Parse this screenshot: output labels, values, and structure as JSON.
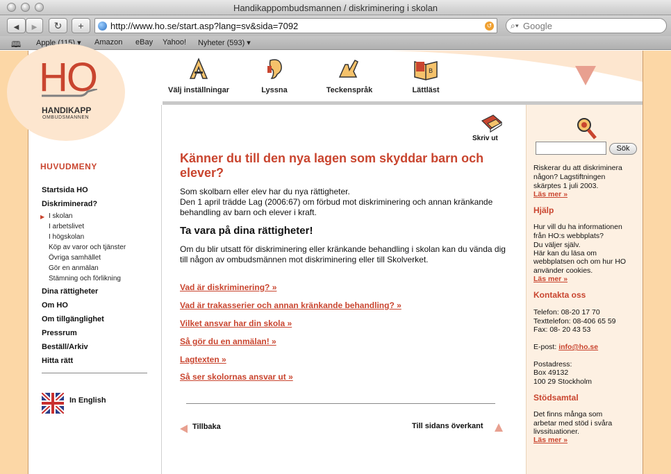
{
  "window": {
    "title": "Handikappombudsmannen / diskriminering i skolan"
  },
  "toolbar": {
    "url": "http://www.ho.se/start.asp?lang=sv&sida=7092",
    "search_placeholder": "Google",
    "back_glyph": "◀",
    "forward_glyph": "▶",
    "reload_glyph": "↻",
    "add_glyph": "+"
  },
  "bookmarks": {
    "items": [
      "Apple (115) ▾",
      "Amazon",
      "eBay",
      "Yahoo!",
      "Nyheter (593) ▾"
    ]
  },
  "header": {
    "logo_text": "HO",
    "logo_name": "HANDIKAPP",
    "logo_sub": "OMBUDSMANNEN",
    "tools": [
      "Välj inställningar",
      "Lyssna",
      "Teckenspråk",
      "Lättläst"
    ]
  },
  "nav": {
    "heading": "HUVUDMENY",
    "main_items": [
      "Startsida HO",
      "Diskriminerad?"
    ],
    "sub_items": [
      "I skolan",
      "I arbetslivet",
      "I högskolan",
      "Köp av varor och tjänster",
      "Övriga samhället",
      "Gör en anmälan",
      "Stämning och förlikning"
    ],
    "main_items_2": [
      "Dina rättigheter",
      "Om HO",
      "Om tillgänglighet",
      "Pressrum",
      "Beställ/Arkiv",
      "Hitta rätt"
    ],
    "english": "In English"
  },
  "main": {
    "print_label": "Skriv ut",
    "title": "Känner du till den nya lagen som skyddar barn och elever?",
    "intro_1": "Som skolbarn eller elev har du nya rättigheter.",
    "intro_2": "Den 1 april trädde Lag (2006:67) om förbud mot diskriminering och annan kränkande behandling av barn och elever i kraft.",
    "subhead": "Ta vara på dina rättigheter!",
    "body": "Om du blir utsatt för diskriminering eller kränkande behandling i skolan kan du vända dig till någon av ombudsmännen mot diskriminering eller till Skolverket.",
    "links": [
      "Vad är diskriminering? »",
      "Vad är trakasserier och annan kränkande behandling? »",
      "Vilket ansvar har din skola »",
      "Så gör du en anmälan! »",
      "Lagtexten »",
      "Så ser skolornas ansvar ut »"
    ],
    "back_label": "Tillbaka",
    "top_label": "Till sidans överkant"
  },
  "right": {
    "search_button": "Sök",
    "intro_1": "Riskerar du att diskriminera",
    "intro_2": "någon? Lagstiftningen",
    "intro_3": "skärptes 1 juli 2003.",
    "more": "Läs mer »",
    "help_heading": "Hjälp",
    "help_1": "Hur vill du ha informationen",
    "help_2": "från HO:s webbplats?",
    "help_3": "Du väljer själv.",
    "help_4": "Här kan du läsa om",
    "help_5": "webbplatsen och om hur HO",
    "help_6": "använder cookies.",
    "contact_heading": "Kontakta oss",
    "phone": "Telefon: 08-20 17 70",
    "textphone": "Texttelefon: 08-406 65 59",
    "fax": "Fax: 08- 20 43 53",
    "email_label": "E-post: ",
    "email": "info@ho.se",
    "post_label": "Postadress:",
    "post_box": "Box 49132",
    "post_city": "100 29 Stockholm",
    "support_heading": "Stödsamtal",
    "support_1": "Det finns många som",
    "support_2": "arbetar med stöd i svåra",
    "support_3": "livssituationer."
  },
  "colors": {
    "accent": "#c9452f",
    "side": "#fcd7a6",
    "panel": "#fdf0e2"
  }
}
